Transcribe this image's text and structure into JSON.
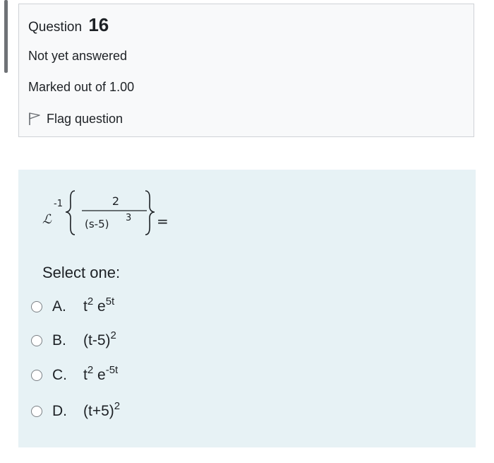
{
  "question": {
    "label": "Question",
    "number": "16",
    "state": "Not yet answered",
    "grade": "Marked out of 1.00",
    "flag_label": "Flag question"
  },
  "formula": {
    "operator": "ℒ",
    "operator_exponent": "-1",
    "numerator": "2",
    "denominator_base": "(s-5)",
    "denominator_exponent": "3",
    "equals": "="
  },
  "prompt": "Select one:",
  "options": [
    {
      "letter": "A.",
      "base": "t",
      "sup1": "2",
      "mid": " e",
      "sup2": "5t"
    },
    {
      "letter": "B.",
      "base": "(t-5)",
      "sup1": "2",
      "mid": "",
      "sup2": ""
    },
    {
      "letter": "C.",
      "base": "t",
      "sup1": "2",
      "mid": " e",
      "sup2": "-5t"
    },
    {
      "letter": "D.",
      "base": "(t+5)",
      "sup1": "2",
      "mid": "",
      "sup2": ""
    }
  ],
  "colors": {
    "info_background": "#f8f9fa",
    "content_background": "#e7f2f5",
    "text": "#1d2125"
  }
}
